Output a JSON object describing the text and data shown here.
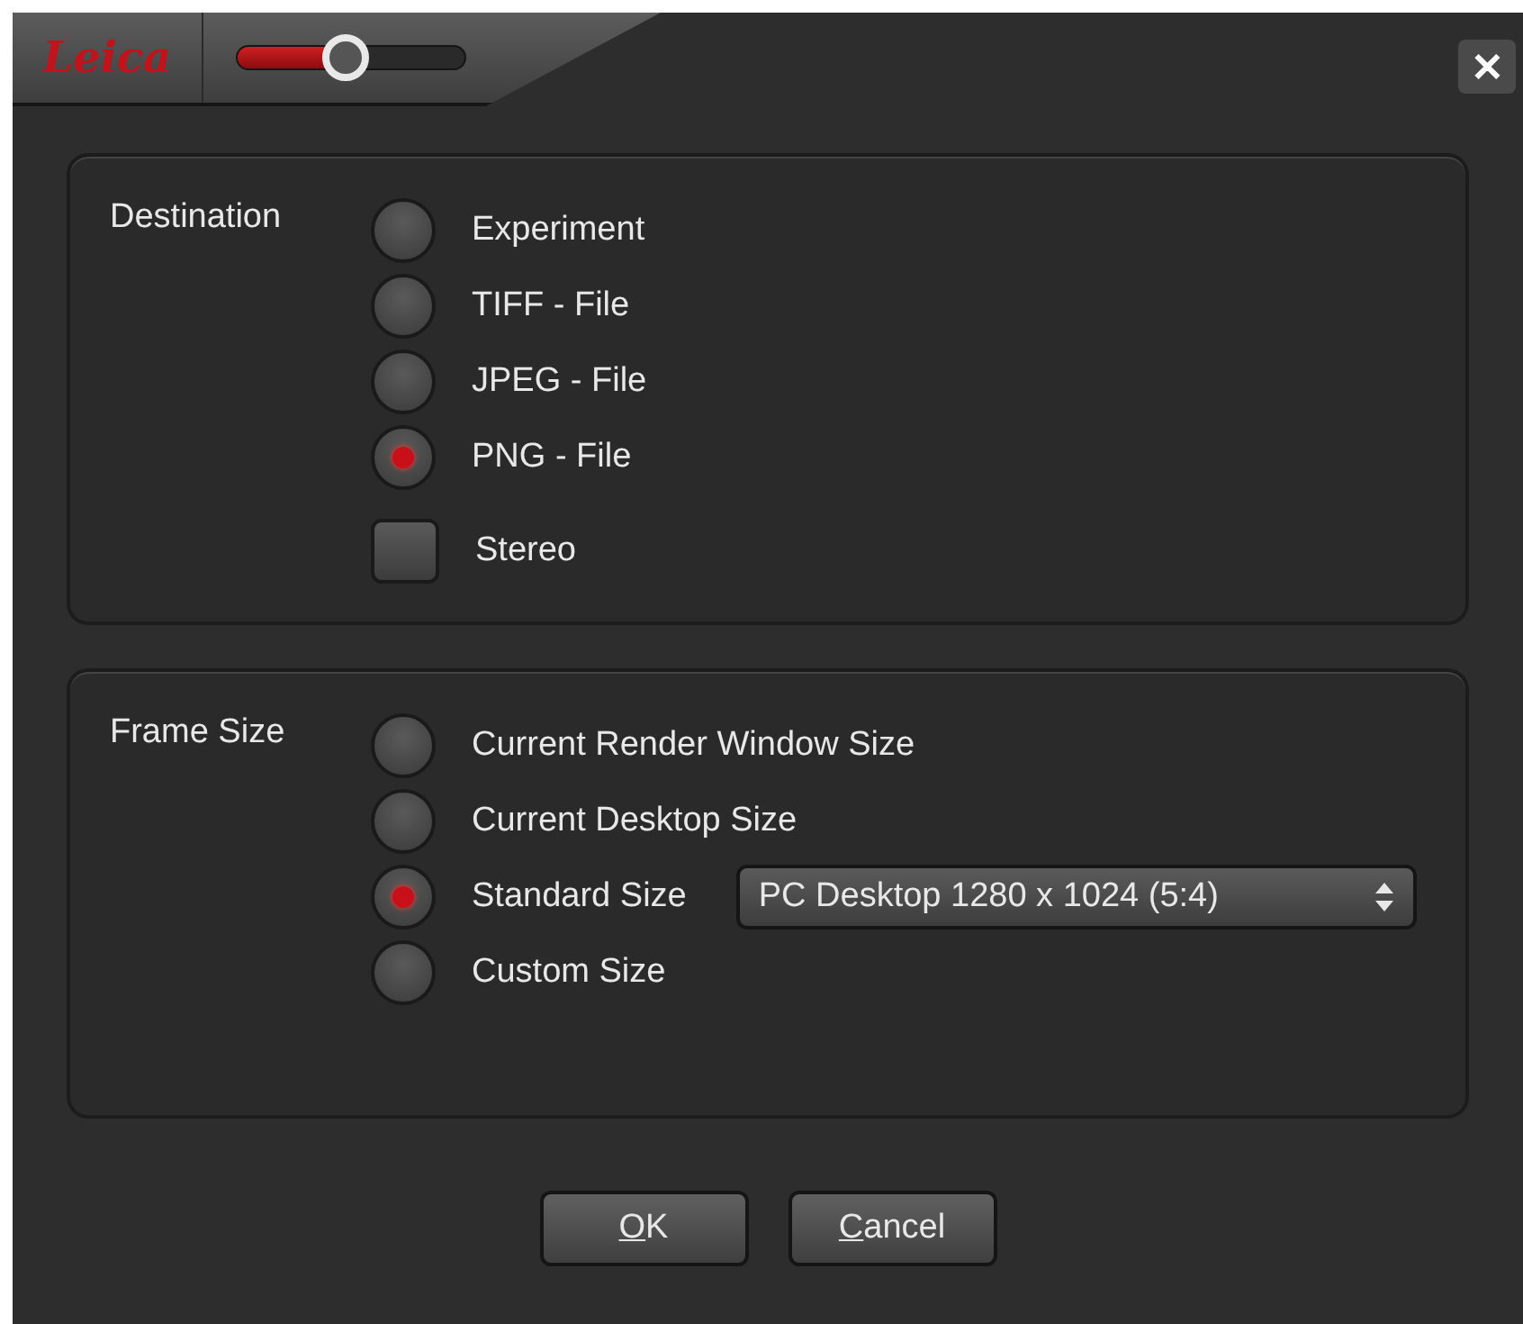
{
  "header": {
    "logo": "Leica",
    "zoom_slider": {
      "level": 0.48
    },
    "close": "✕"
  },
  "groups": [
    {
      "title": "Destination",
      "options": [
        {
          "kind": "radio",
          "label": "Experiment",
          "selected": false
        },
        {
          "kind": "radio",
          "label": "TIFF - File",
          "selected": false
        },
        {
          "kind": "radio",
          "label": "JPEG - File",
          "selected": false
        },
        {
          "kind": "radio",
          "label": "PNG - File",
          "selected": true
        },
        {
          "kind": "checkbox",
          "label": "Stereo",
          "checked": false
        }
      ]
    },
    {
      "title": "Frame Size",
      "options": [
        {
          "kind": "radio",
          "label": "Current Render Window Size",
          "selected": false
        },
        {
          "kind": "radio",
          "label": "Current Desktop Size",
          "selected": false
        },
        {
          "kind": "radio",
          "label": "Standard Size",
          "selected": true,
          "dropdown": {
            "value": "PC Desktop 1280 x 1024 (5:4)"
          }
        },
        {
          "kind": "radio",
          "label": "Custom Size",
          "selected": false
        }
      ]
    }
  ],
  "buttons": [
    {
      "label": "OK"
    },
    {
      "label": "Cancel"
    }
  ]
}
